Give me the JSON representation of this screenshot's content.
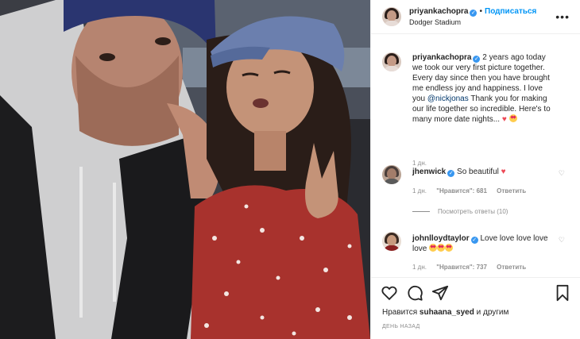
{
  "header": {
    "username": "priyankachopra",
    "verified": "✓",
    "separator": "•",
    "follow_label": "Подписаться",
    "location": "Dodger Stadium",
    "more": "•••"
  },
  "caption": {
    "username": "priyankachopra",
    "text_before": "2 years ago today we took our very first picture together. Every day since then you have brought me endless joy and happiness. I love you ",
    "mention": "@nickjonas",
    "text_after": " Thank you for making our life together so incredible. Here's to many more date nights... ",
    "age": "1 дн."
  },
  "comments": [
    {
      "username": "jhenwick",
      "text": "So beautiful ",
      "age": "1 дн.",
      "likes": "\"Нравится\": 681",
      "reply": "Ответить",
      "view_replies": "Посмотреть ответы (10)"
    },
    {
      "username": "johnlloydtaylor",
      "text": "Love love love love love ",
      "age": "1 дн.",
      "likes": "\"Нравится\": 737",
      "reply": "Ответить"
    }
  ],
  "footer": {
    "likes_prefix": "Нравится ",
    "liked_by": "suhaana_syed",
    "likes_suffix": " и другим",
    "timestamp": "ДЕНЬ НАЗАД"
  },
  "icons": {
    "like": "heart-icon",
    "comment": "comment-icon",
    "share": "share-icon",
    "save": "bookmark-icon"
  },
  "colors": {
    "accent": "#0095f6",
    "verified": "#3897f0",
    "heart": "#ed4956",
    "muted": "#8e8e8e"
  }
}
